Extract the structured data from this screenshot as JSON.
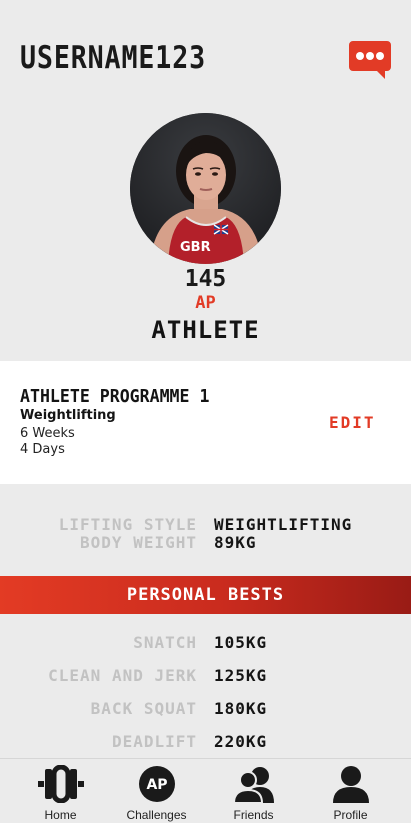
{
  "header": {
    "username": "USERNAME123",
    "chat_icon": "chat-bubble-icon",
    "accent_color": "#e23b26"
  },
  "profile": {
    "avatar": "athlete-photo",
    "points_value": "145",
    "points_unit": "AP",
    "role": "ATHLETE"
  },
  "programme": {
    "title": "ATHLETE PROGRAMME 1",
    "sport": "Weightlifting",
    "duration": "6 Weeks",
    "frequency": "4 Days",
    "edit_label": "EDIT"
  },
  "details": [
    {
      "label": "LIFTING STYLE",
      "value": "WEIGHTLIFTING"
    },
    {
      "label": "BODY WEIGHT",
      "value": "89KG"
    }
  ],
  "personal_bests": {
    "title": "PERSONAL BESTS",
    "items": [
      {
        "label": "SNATCH",
        "value": "105KG"
      },
      {
        "label": "CLEAN AND JERK",
        "value": "125KG"
      },
      {
        "label": "BACK SQUAT",
        "value": "180KG"
      },
      {
        "label": "DEADLIFT",
        "value": "220KG"
      }
    ]
  },
  "nav": {
    "items": [
      {
        "label": "Home",
        "icon": "barbell-plate-icon"
      },
      {
        "label": "Challenges",
        "icon": "ap-badge-icon"
      },
      {
        "label": "Friends",
        "icon": "friends-icon"
      },
      {
        "label": "Profile",
        "icon": "profile-icon"
      }
    ],
    "ap_badge_text": "AP"
  }
}
